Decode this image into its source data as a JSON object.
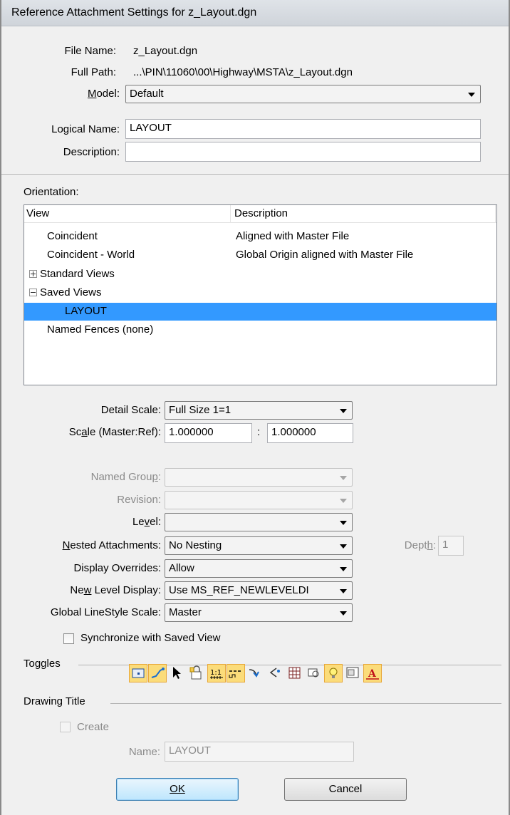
{
  "window": {
    "title": "Reference Attachment Settings for z_Layout.dgn"
  },
  "file": {
    "name_label": "File Name:",
    "name_value": "z_Layout.dgn",
    "path_label": "Full Path:",
    "path_value": "...\\PIN\\11060\\00\\Highway\\MSTA\\z_Layout.dgn",
    "model_label_pre": "",
    "model_label_u": "M",
    "model_label_post": "odel:",
    "model_value": "Default",
    "logical_label_pre": "Lo",
    "logical_label_u": "g",
    "logical_label_post": "ical Name:",
    "logical_value": "LAYOUT",
    "description_label": "Description:",
    "description_value": ""
  },
  "orientation": {
    "label": "Orientation:",
    "columns": [
      "View",
      "Description"
    ],
    "rows": [
      {
        "view": "Coincident",
        "desc": "Aligned with Master File"
      },
      {
        "view": "Coincident - World",
        "desc": "Global Origin aligned with Master File"
      },
      {
        "view": "Standard Views",
        "desc": "",
        "expander": "plus"
      },
      {
        "view": "Saved Views",
        "desc": "",
        "expander": "minus"
      },
      {
        "view": "LAYOUT",
        "desc": "",
        "selected": true
      },
      {
        "view": "Named Fences (none)",
        "desc": ""
      }
    ]
  },
  "scale": {
    "detail_label": "Detail Scale:",
    "detail_value": "Full Size 1=1",
    "ratio_label_pre": "Sc",
    "ratio_label_u": "a",
    "ratio_label_post": "le (Master:Ref):",
    "master": "1.000000",
    "colon": ":",
    "ref": "1.000000"
  },
  "settings": {
    "named_group_label_pre": "Named Grou",
    "named_group_label_u": "p",
    "named_group_label_post": ":",
    "named_group_value": "",
    "revision_label": "Revision:",
    "revision_value": "",
    "level_label_pre": "Le",
    "level_label_u": "v",
    "level_label_post": "el:",
    "level_value": "",
    "nested_label_pre": "",
    "nested_label_u": "N",
    "nested_label_post": "ested Attachments:",
    "nested_value": "No Nesting",
    "depth_label_pre": "Dept",
    "depth_label_u": "h",
    "depth_label_post": ":",
    "depth_value": "1",
    "display_overrides_label": "Display Overrides:",
    "display_overrides_value": "Allow",
    "new_level_label_pre": "Ne",
    "new_level_label_u": "w",
    "new_level_label_post": " Level Display:",
    "new_level_value": "Use MS_REF_NEWLEVELDI",
    "linestyle_label": "Global LineStyle Scale:",
    "linestyle_value": "Master",
    "sync_label": "Synchronize with Saved View"
  },
  "toggles": {
    "label": "Toggles"
  },
  "drawing_title": {
    "label": "Drawing Title",
    "create_label": "Create",
    "name_label": "Name:",
    "name_value": "LAYOUT"
  },
  "buttons": {
    "ok": "OK",
    "cancel": "Cancel"
  },
  "colors": {
    "selection": "#3399ff",
    "toggle_on": "#fbdc7a",
    "dialog_bg": "#f0f0f0"
  }
}
